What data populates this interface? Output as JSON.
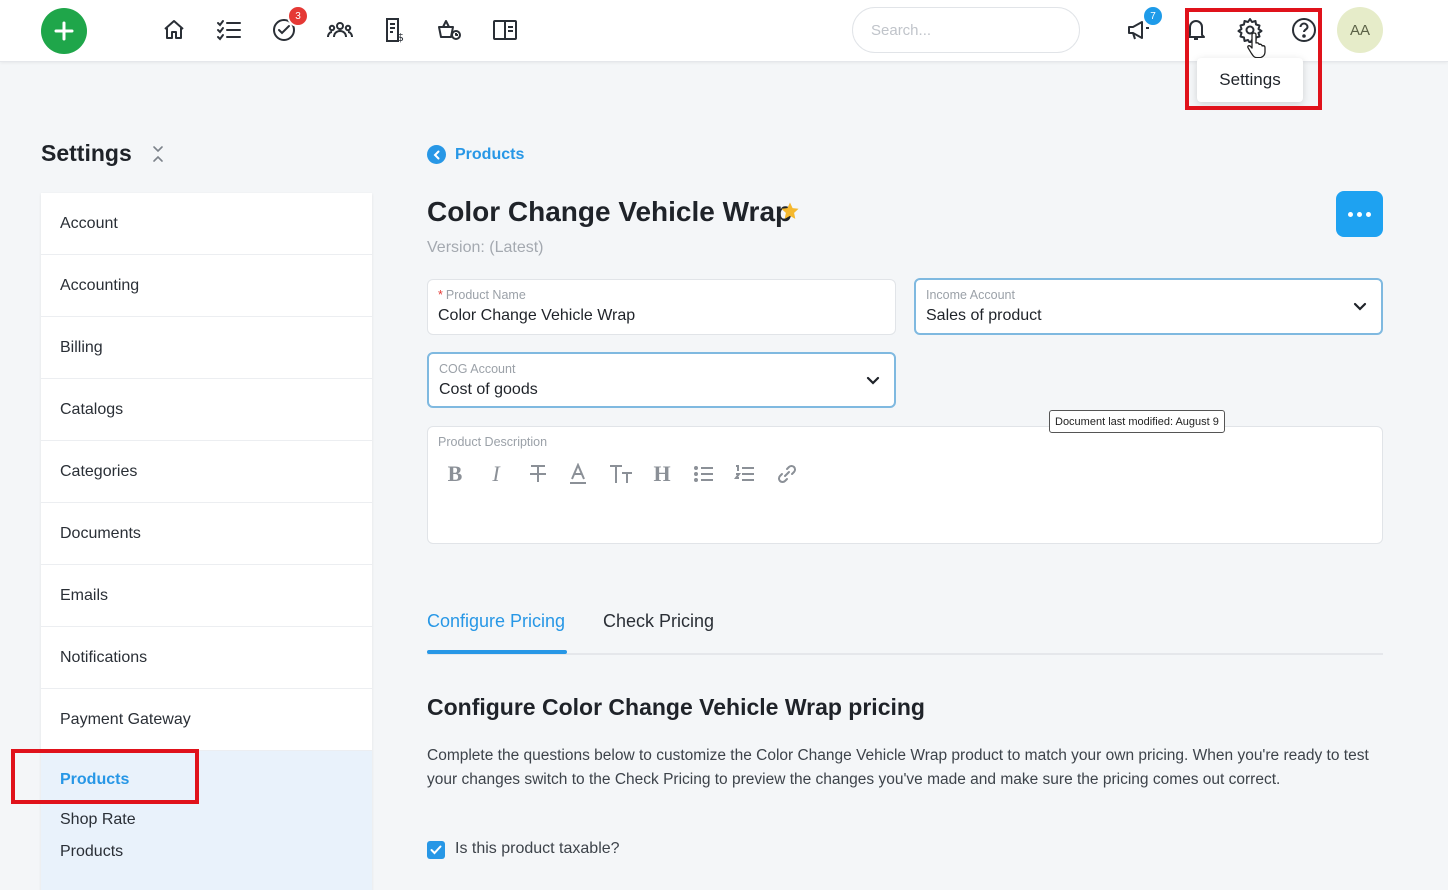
{
  "topbar": {
    "search_placeholder": "Search...",
    "tasks_badge": "3",
    "announcements_badge": "7",
    "avatar_initials": "AA",
    "settings_tooltip": "Settings"
  },
  "sidebar": {
    "title": "Settings",
    "items": [
      {
        "label": "Account"
      },
      {
        "label": "Accounting"
      },
      {
        "label": "Billing"
      },
      {
        "label": "Catalogs"
      },
      {
        "label": "Categories"
      },
      {
        "label": "Documents"
      },
      {
        "label": "Emails"
      },
      {
        "label": "Notifications"
      },
      {
        "label": "Payment Gateway"
      }
    ],
    "active_item": "Products",
    "sub_items": [
      {
        "label": "Shop Rate"
      },
      {
        "label": "Products"
      }
    ]
  },
  "main": {
    "breadcrumb": "Products",
    "title": "Color Change Vehicle Wrap",
    "version": "Version: (Latest)",
    "product_name": {
      "label": "Product Name",
      "required_mark": "*",
      "value": "Color Change Vehicle Wrap"
    },
    "income_account": {
      "label": "Income Account",
      "value": "Sales of product"
    },
    "cog_account": {
      "label": "COG Account",
      "value": "Cost of goods"
    },
    "description_label": "Product Description",
    "doc_tooltip": "Document last modified: August 9",
    "tabs": [
      {
        "label": "Configure Pricing"
      },
      {
        "label": "Check Pricing"
      }
    ],
    "section_title": "Configure Color Change Vehicle Wrap pricing",
    "section_text": "Complete the questions below to customize the Color Change Vehicle Wrap product to match your own pricing. When you're ready to test your changes switch to the Check Pricing to preview the changes you've made and make sure the pricing comes out correct.",
    "taxable_label": "Is this product taxable?"
  },
  "colors": {
    "accent": "#2797e6",
    "add_button": "#1fa64a",
    "highlight": "#e0121b",
    "star": "#f5b82e"
  }
}
